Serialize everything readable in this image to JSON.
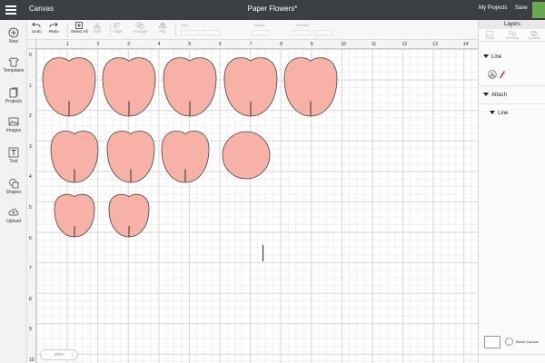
{
  "header": {
    "app_title": "Canvas",
    "doc_title": "Paper Flowers*",
    "my_projects": "My Projects",
    "save": "Save"
  },
  "leftbar": {
    "items": [
      {
        "label": "New",
        "icon": "plus-icon"
      },
      {
        "label": "Templates",
        "icon": "shirt-icon"
      },
      {
        "label": "Projects",
        "icon": "projects-icon"
      },
      {
        "label": "Images",
        "icon": "image-icon"
      },
      {
        "label": "Text",
        "icon": "text-icon"
      },
      {
        "label": "Shapes",
        "icon": "shapes-icon"
      },
      {
        "label": "Upload",
        "icon": "upload-icon"
      }
    ]
  },
  "toolbar": {
    "undo": "Undo",
    "redo": "Redo",
    "select_all": "Select All",
    "edit": "Edit",
    "align": "Align",
    "arrange": "Arrange",
    "flip": "Flip",
    "size": "Size",
    "rotate": "Rotate",
    "position": "Position"
  },
  "layers": {
    "title": "Layers",
    "tools": [
      "Group",
      "UnGroup",
      "Duplicate"
    ],
    "rows": [
      {
        "label": "Line"
      },
      {
        "label": "Attach"
      },
      {
        "label": "Line"
      }
    ],
    "blank_canvas": "Blank Canvas"
  },
  "canvas": {
    "ruler_top": [
      "1",
      "2",
      "3",
      "4",
      "5",
      "6",
      "7",
      "8",
      "9",
      "10",
      "11",
      "12",
      "13",
      "14"
    ],
    "ruler_left": [
      "0",
      "1",
      "2",
      "3",
      "4",
      "5",
      "6",
      "7",
      "8",
      "9",
      "10"
    ],
    "shape_fill": "#f8b1a6",
    "shape_stroke": "#444444",
    "zoom": "100%",
    "petal_count": 11,
    "circle_count": 1
  }
}
